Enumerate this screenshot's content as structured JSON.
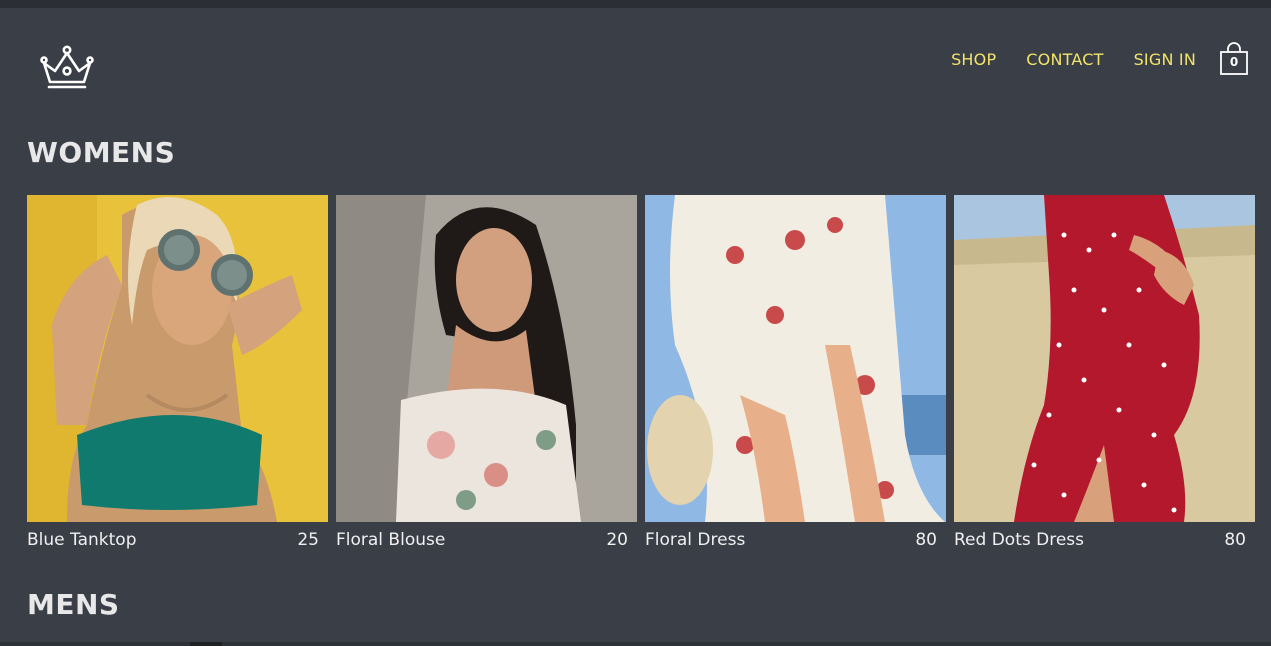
{
  "nav": {
    "shop": "SHOP",
    "contact": "CONTACT",
    "signin": "SIGN IN",
    "cart_count": "0"
  },
  "sections": {
    "womens": "WOMENS",
    "mens": "MENS"
  },
  "products": [
    {
      "name": "Blue Tanktop",
      "price": "25"
    },
    {
      "name": "Floral Blouse",
      "price": "20"
    },
    {
      "name": "Floral Dress",
      "price": "80"
    },
    {
      "name": "Red Dots Dress",
      "price": "80"
    }
  ],
  "colors": {
    "background": "#3a3e47",
    "nav_link": "#f2e46a",
    "text": "#f0f0f0"
  },
  "icons": {
    "logo": "crown-icon",
    "cart": "shopping-bag-icon"
  }
}
